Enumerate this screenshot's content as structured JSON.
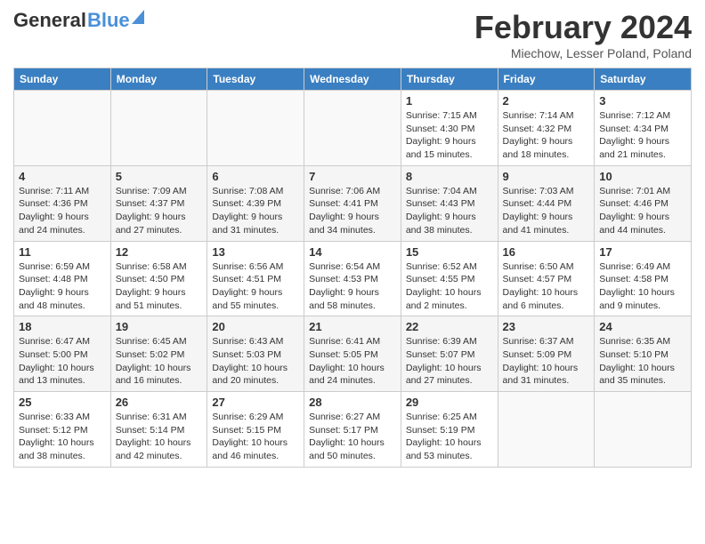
{
  "header": {
    "logo_general": "General",
    "logo_blue": "Blue",
    "month_title": "February 2024",
    "location": "Miechow, Lesser Poland, Poland"
  },
  "days_of_week": [
    "Sunday",
    "Monday",
    "Tuesday",
    "Wednesday",
    "Thursday",
    "Friday",
    "Saturday"
  ],
  "weeks": [
    [
      {
        "num": "",
        "info": ""
      },
      {
        "num": "",
        "info": ""
      },
      {
        "num": "",
        "info": ""
      },
      {
        "num": "",
        "info": ""
      },
      {
        "num": "1",
        "info": "Sunrise: 7:15 AM\nSunset: 4:30 PM\nDaylight: 9 hours\nand 15 minutes."
      },
      {
        "num": "2",
        "info": "Sunrise: 7:14 AM\nSunset: 4:32 PM\nDaylight: 9 hours\nand 18 minutes."
      },
      {
        "num": "3",
        "info": "Sunrise: 7:12 AM\nSunset: 4:34 PM\nDaylight: 9 hours\nand 21 minutes."
      }
    ],
    [
      {
        "num": "4",
        "info": "Sunrise: 7:11 AM\nSunset: 4:36 PM\nDaylight: 9 hours\nand 24 minutes."
      },
      {
        "num": "5",
        "info": "Sunrise: 7:09 AM\nSunset: 4:37 PM\nDaylight: 9 hours\nand 27 minutes."
      },
      {
        "num": "6",
        "info": "Sunrise: 7:08 AM\nSunset: 4:39 PM\nDaylight: 9 hours\nand 31 minutes."
      },
      {
        "num": "7",
        "info": "Sunrise: 7:06 AM\nSunset: 4:41 PM\nDaylight: 9 hours\nand 34 minutes."
      },
      {
        "num": "8",
        "info": "Sunrise: 7:04 AM\nSunset: 4:43 PM\nDaylight: 9 hours\nand 38 minutes."
      },
      {
        "num": "9",
        "info": "Sunrise: 7:03 AM\nSunset: 4:44 PM\nDaylight: 9 hours\nand 41 minutes."
      },
      {
        "num": "10",
        "info": "Sunrise: 7:01 AM\nSunset: 4:46 PM\nDaylight: 9 hours\nand 44 minutes."
      }
    ],
    [
      {
        "num": "11",
        "info": "Sunrise: 6:59 AM\nSunset: 4:48 PM\nDaylight: 9 hours\nand 48 minutes."
      },
      {
        "num": "12",
        "info": "Sunrise: 6:58 AM\nSunset: 4:50 PM\nDaylight: 9 hours\nand 51 minutes."
      },
      {
        "num": "13",
        "info": "Sunrise: 6:56 AM\nSunset: 4:51 PM\nDaylight: 9 hours\nand 55 minutes."
      },
      {
        "num": "14",
        "info": "Sunrise: 6:54 AM\nSunset: 4:53 PM\nDaylight: 9 hours\nand 58 minutes."
      },
      {
        "num": "15",
        "info": "Sunrise: 6:52 AM\nSunset: 4:55 PM\nDaylight: 10 hours\nand 2 minutes."
      },
      {
        "num": "16",
        "info": "Sunrise: 6:50 AM\nSunset: 4:57 PM\nDaylight: 10 hours\nand 6 minutes."
      },
      {
        "num": "17",
        "info": "Sunrise: 6:49 AM\nSunset: 4:58 PM\nDaylight: 10 hours\nand 9 minutes."
      }
    ],
    [
      {
        "num": "18",
        "info": "Sunrise: 6:47 AM\nSunset: 5:00 PM\nDaylight: 10 hours\nand 13 minutes."
      },
      {
        "num": "19",
        "info": "Sunrise: 6:45 AM\nSunset: 5:02 PM\nDaylight: 10 hours\nand 16 minutes."
      },
      {
        "num": "20",
        "info": "Sunrise: 6:43 AM\nSunset: 5:03 PM\nDaylight: 10 hours\nand 20 minutes."
      },
      {
        "num": "21",
        "info": "Sunrise: 6:41 AM\nSunset: 5:05 PM\nDaylight: 10 hours\nand 24 minutes."
      },
      {
        "num": "22",
        "info": "Sunrise: 6:39 AM\nSunset: 5:07 PM\nDaylight: 10 hours\nand 27 minutes."
      },
      {
        "num": "23",
        "info": "Sunrise: 6:37 AM\nSunset: 5:09 PM\nDaylight: 10 hours\nand 31 minutes."
      },
      {
        "num": "24",
        "info": "Sunrise: 6:35 AM\nSunset: 5:10 PM\nDaylight: 10 hours\nand 35 minutes."
      }
    ],
    [
      {
        "num": "25",
        "info": "Sunrise: 6:33 AM\nSunset: 5:12 PM\nDaylight: 10 hours\nand 38 minutes."
      },
      {
        "num": "26",
        "info": "Sunrise: 6:31 AM\nSunset: 5:14 PM\nDaylight: 10 hours\nand 42 minutes."
      },
      {
        "num": "27",
        "info": "Sunrise: 6:29 AM\nSunset: 5:15 PM\nDaylight: 10 hours\nand 46 minutes."
      },
      {
        "num": "28",
        "info": "Sunrise: 6:27 AM\nSunset: 5:17 PM\nDaylight: 10 hours\nand 50 minutes."
      },
      {
        "num": "29",
        "info": "Sunrise: 6:25 AM\nSunset: 5:19 PM\nDaylight: 10 hours\nand 53 minutes."
      },
      {
        "num": "",
        "info": ""
      },
      {
        "num": "",
        "info": ""
      }
    ]
  ]
}
